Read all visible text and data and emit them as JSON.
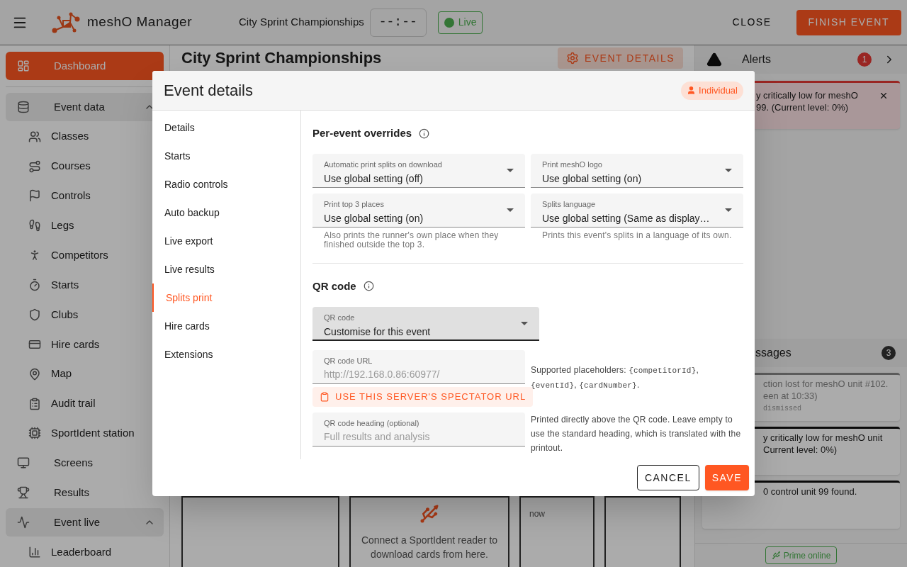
{
  "app_bar": {
    "title": "meshO Manager",
    "event_name": "City Sprint Championships",
    "clock": "--:--",
    "status": {
      "label": "Live",
      "on": true
    },
    "actions": [
      {
        "label": "CLOSE",
        "kind": "text"
      },
      {
        "label": "FINISH EVENT",
        "kind": "primary"
      }
    ]
  },
  "sidebar": {
    "items": [
      {
        "label": "Dashboard",
        "selected": true
      },
      {
        "label": "Event data",
        "kind": "group",
        "expanded": true,
        "selected": false,
        "children": [
          {
            "label": "Classes",
            "selected": false
          },
          {
            "label": "Courses",
            "selected": false
          },
          {
            "label": "Controls",
            "selected": false
          },
          {
            "label": "Legs",
            "selected": false
          },
          {
            "label": "Competitors",
            "selected": false
          },
          {
            "label": "Starts",
            "selected": false
          },
          {
            "label": "Clubs",
            "selected": false
          },
          {
            "label": "Hire cards",
            "selected": false
          },
          {
            "label": "Map",
            "selected": false
          },
          {
            "label": "Audit trail",
            "selected": false
          },
          {
            "label": "SportIdent station",
            "selected": false
          }
        ]
      },
      {
        "label": "Screens",
        "selected": false
      },
      {
        "label": "Results",
        "selected": false
      },
      {
        "label": "Event live",
        "kind": "group",
        "expanded": true,
        "selected": false,
        "children": [
          {
            "label": "Leaderboard",
            "selected": false
          }
        ]
      }
    ]
  },
  "main": {
    "title": "City Sprint Championships",
    "action": "EVENT DETAILS",
    "cards": [
      {
        "kind": "empty"
      },
      {
        "kind": "reader",
        "text": "Connect a SportIdent reader to download cards from here."
      },
      {
        "kind": "log",
        "text": "now"
      },
      {
        "kind": "empty"
      }
    ]
  },
  "right_panel": {
    "alerts": {
      "title": "Alerts",
      "count": "1",
      "items": [
        {
          "lines": [
            "y critically low for meshO",
            "99. (Current level: 0%)"
          ]
        }
      ]
    },
    "messages": {
      "title": "ssages",
      "count": "3",
      "items": [
        {
          "lines": [
            "ction lost for meshO unit #102.",
            "een at 10:33)"
          ],
          "meta": "dismissed",
          "dismissed": true
        },
        {
          "lines": [
            "y critically low for meshO unit",
            "Current level: 0%)"
          ],
          "dismissed": false
        },
        {
          "lines": [
            "0 control unit 99 found."
          ],
          "dismissed": false
        }
      ]
    },
    "footer": "Prime online"
  },
  "dialog": {
    "title": "Event details",
    "badge": "Individual",
    "nav": [
      {
        "label": "Details",
        "selected": false
      },
      {
        "label": "Starts",
        "selected": false
      },
      {
        "label": "Radio controls",
        "selected": false
      },
      {
        "label": "Auto backup",
        "selected": false
      },
      {
        "label": "Live export",
        "selected": false
      },
      {
        "label": "Live results",
        "selected": false
      },
      {
        "label": "Splits print",
        "selected": true
      },
      {
        "label": "Hire cards",
        "selected": false
      },
      {
        "label": "Extensions",
        "selected": false
      }
    ],
    "overrides": {
      "title": "Per-event overrides",
      "fields": [
        {
          "label": "Automatic print splits on download",
          "value": "Use global setting (off)"
        },
        {
          "label": "Print meshO logo",
          "value": "Use global setting (on)"
        },
        {
          "label": "Print top 3 places",
          "value": "Use global setting (on)",
          "helper": "Also prints the runner's own place when they finished outside the top 3."
        },
        {
          "label": "Splits language",
          "value": "Use global setting (Same as display…",
          "helper": "Prints this event's splits in a language of its own."
        }
      ]
    },
    "qr": {
      "title": "QR code",
      "select": {
        "label": "QR code",
        "value": "Customise for this event",
        "focused": true
      },
      "fields": [
        {
          "label": "QR code URL",
          "placeholder": "http://192.168.0.86:60977/",
          "action": "USE THIS SERVER'S SPECTATOR URL",
          "note": [
            {
              "kind": "text",
              "text": "Supported placeholders: "
            },
            {
              "kind": "code",
              "text": "{competitorId}"
            },
            {
              "kind": "text",
              "text": ", "
            },
            {
              "kind": "code",
              "text": "{eventId}"
            },
            {
              "kind": "text",
              "text": ", "
            },
            {
              "kind": "code",
              "text": "{cardNumber}"
            },
            {
              "kind": "text",
              "text": "."
            }
          ]
        },
        {
          "label": "QR code heading (optional)",
          "placeholder": "Full results and analysis",
          "note": [
            {
              "kind": "text",
              "text": "Printed directly above the QR code. Leave empty to use the standard heading, which is translated with the printout."
            }
          ]
        }
      ]
    },
    "buttons": [
      {
        "label": "CANCEL",
        "kind": "outlined"
      },
      {
        "label": "SAVE",
        "kind": "primary"
      }
    ]
  }
}
